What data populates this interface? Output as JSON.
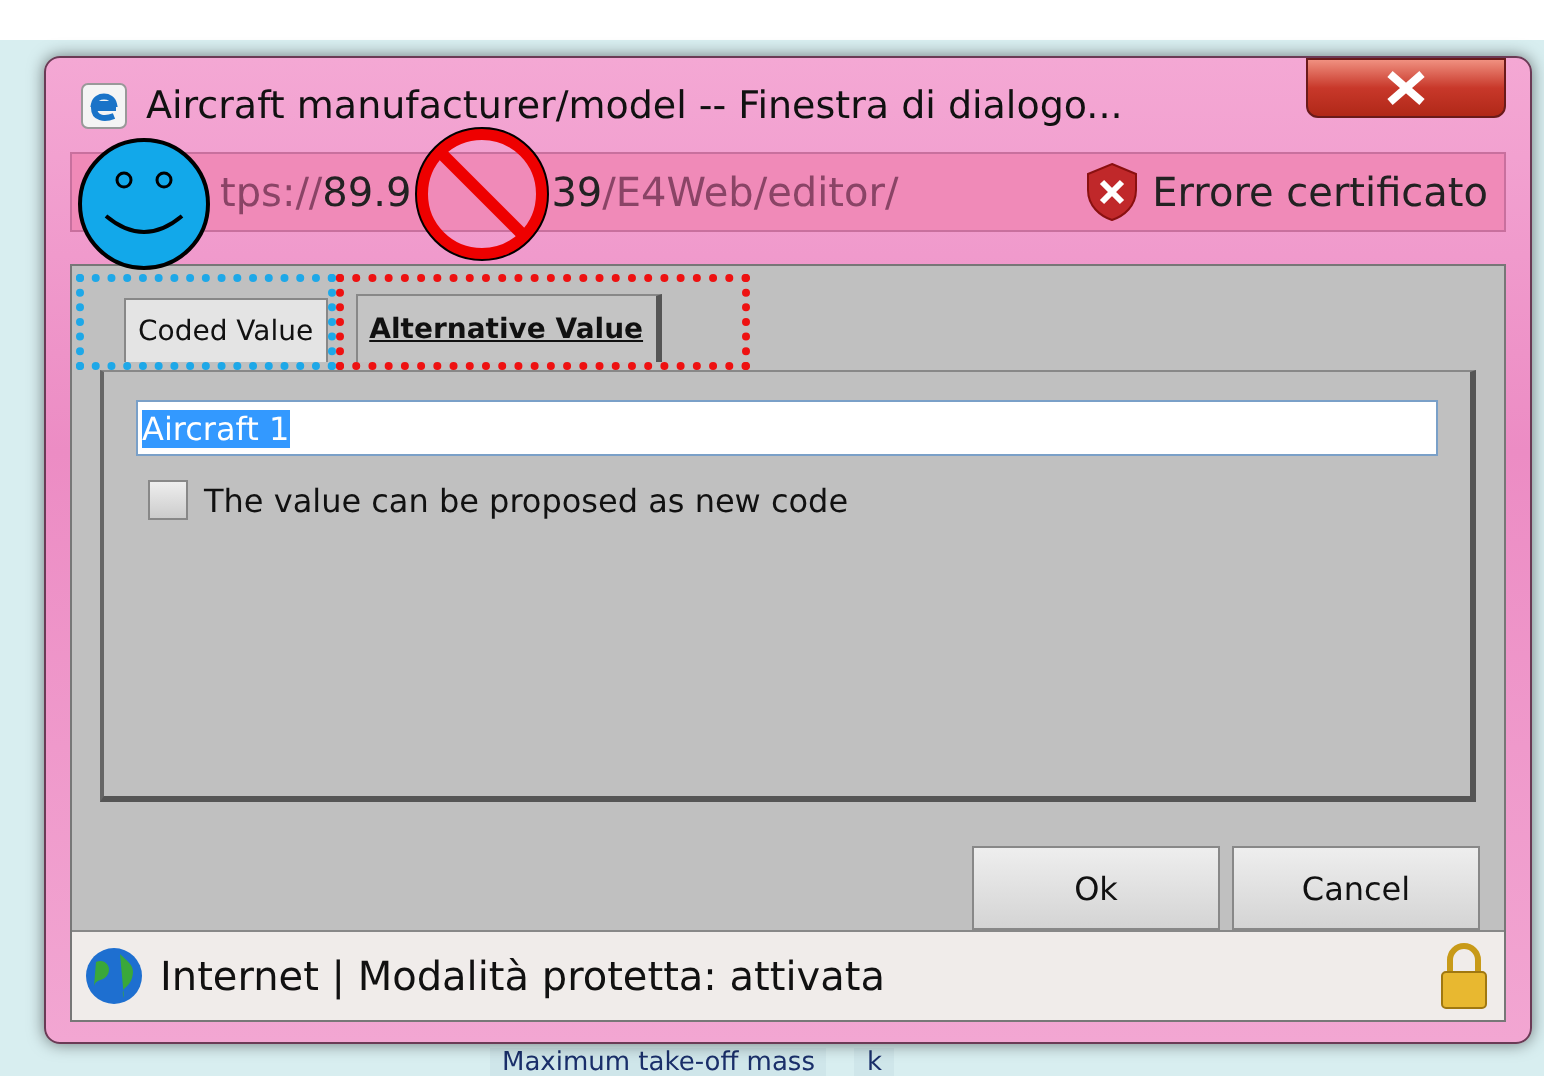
{
  "window": {
    "title": "Aircraft manufacturer/model -- Finestra di dialogo..."
  },
  "address": {
    "segments": [
      {
        "kind": "smiley"
      },
      {
        "kind": "text",
        "text": "tps://",
        "emphasis": false
      },
      {
        "kind": "text",
        "text": "89.9",
        "emphasis": true
      },
      {
        "kind": "no-sign"
      },
      {
        "kind": "text",
        "text": "39",
        "emphasis": true
      },
      {
        "kind": "text",
        "text": "/E4Web/editor/",
        "emphasis": false
      }
    ],
    "certificate": "Errore certificato"
  },
  "tabs": [
    {
      "label": "Coded Value",
      "selected": false,
      "color": "#1ea8e8"
    },
    {
      "label": "Alternative Value",
      "selected": true,
      "color": "#ee1111"
    }
  ],
  "field": {
    "value": "Aircraft 1",
    "highlighted": true
  },
  "checkbox": {
    "label": "The value can be proposed as new code",
    "checked": false
  },
  "buttons": [
    "Ok",
    "Cancel"
  ],
  "status_bar": {
    "text": "Internet | Modalità protetta: attivata"
  },
  "background": {
    "texts": [
      "Maximum take-off mass",
      "k"
    ]
  }
}
